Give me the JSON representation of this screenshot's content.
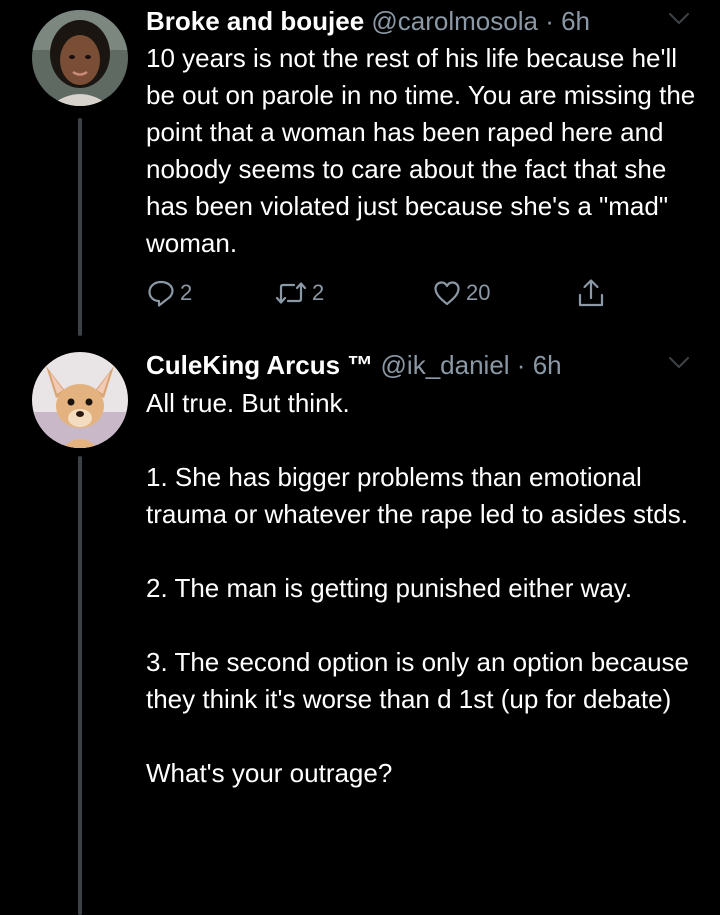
{
  "colors": {
    "background": "#000000",
    "text_primary": "#ffffff",
    "text_secondary": "#8b98a5",
    "thread_line": "#3d4247"
  },
  "tweets": [
    {
      "display_name": "Broke and boujee",
      "handle": "@carolmosola",
      "separator": "·",
      "time": "6h",
      "text": [
        "10 years is not the rest of his life because he'll be out on parole in no time. You are missing the point that a woman has been raped here and nobody seems to care about the fact that she has been violated just because she's a \"mad\" woman."
      ],
      "actions": {
        "replies": "2",
        "retweets": "2",
        "likes": "20"
      },
      "icons": [
        "avatar-woman",
        "caret-down-icon",
        "reply-icon",
        "retweet-icon",
        "heart-icon",
        "share-icon"
      ]
    },
    {
      "display_name": "CuleKing Arcus ™",
      "handle": "@ik_daniel",
      "separator": "·",
      "time": "6h",
      "text": [
        "All true. But think.",
        "1. She has bigger problems than emotional trauma or whatever the rape led to asides stds.",
        "2. The man is getting punished either way.",
        "3. The second option is only an option because they think it's worse than d 1st (up for debate)",
        "What's your outrage?"
      ],
      "icons": [
        "avatar-chihuahua",
        "caret-down-icon"
      ]
    }
  ]
}
